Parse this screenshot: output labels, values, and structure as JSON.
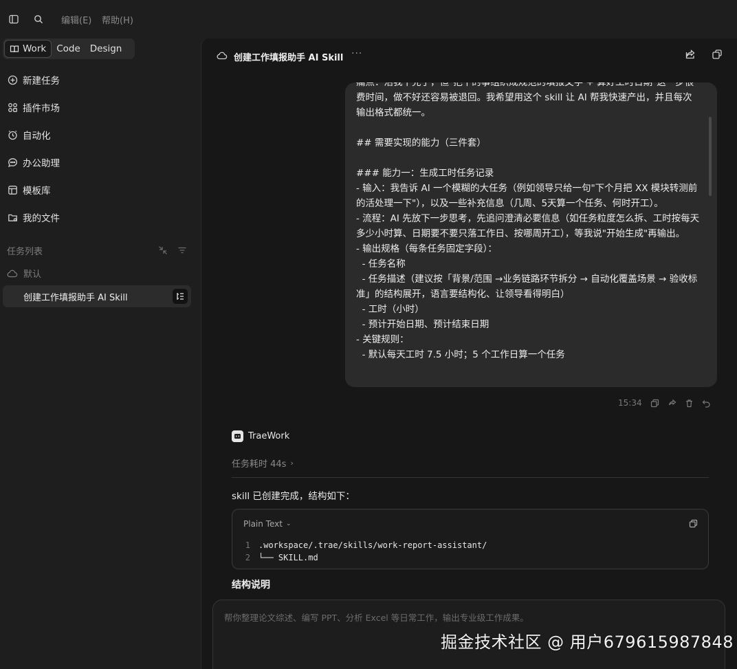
{
  "topbar": {
    "menu": [
      {
        "label": "编辑(E)"
      },
      {
        "label": "帮助(H)"
      }
    ]
  },
  "sidebar": {
    "modes": [
      {
        "label": "Work",
        "active": true
      },
      {
        "label": "Code",
        "active": false
      },
      {
        "label": "Design",
        "active": false
      }
    ],
    "nav": [
      {
        "label": "新建任务",
        "icon": "plus-circle-icon"
      },
      {
        "label": "插件市场",
        "icon": "plugins-icon"
      },
      {
        "label": "自动化",
        "icon": "clock-icon"
      },
      {
        "label": "办公助理",
        "icon": "chat-icon"
      },
      {
        "label": "模板库",
        "icon": "template-icon"
      },
      {
        "label": "我的文件",
        "icon": "folder-icon"
      }
    ],
    "tasks_header": "任务列表",
    "group_label": "默认",
    "active_task": "创建工作填报助手 AI Skill"
  },
  "main": {
    "title": "创建工作填报助手 AI Skill",
    "user_message": "痛点：活我干完了，但\"把干的事组织成规范的填报文字 + 算好工时日期\"这一步很费时间，做不好还容易被退回。我希望用这个 skill 让 AI 帮我快速产出，并且每次输出格式都统一。\n\n## 需要实现的能力（三件套）\n\n### 能力一：生成工时任务记录\n- 输入：我告诉 AI 一个模糊的大任务（例如领导只给一句\"下个月把 XX 模块转测前的活处理一下\"），以及一些补充信息（几周、5天算一个任务、何时开工）。\n- 流程：AI 先放下一步思考，先追问澄清必要信息（如任务粒度怎么拆、工时按每天多少小时算、日期要不要只落工作日、按哪周开工），等我说\"开始生成\"再输出。\n- 输出规格（每条任务固定字段）：\n  - 任务名称\n  - 任务描述（建议按「背景/范围 →业务链路环节拆分 → 自动化覆盖场景 → 验收标准」的结构展开，语言要结构化、让领导看得明白）\n  - 工时（小时）\n  - 预计开始日期、预计结束日期\n- 关键规则：\n  - 默认每天工时 7.5 小时；5 个工作日算一个任务",
    "message_time": "15:34",
    "assistant": {
      "name": "TraeWork",
      "elapsed": "任务耗时 44s",
      "intro": "skill 已创建完成，结构如下：",
      "code_lang": "Plain Text",
      "code_lines": [
        {
          "num": "1",
          "text": ".workspace/.trae/skills/work-report-assistant/"
        },
        {
          "num": "2",
          "text": "└── SKILL.md"
        }
      ],
      "section_title": "结构说明"
    },
    "composer_placeholder": "帮你整理论文综述、编写 PPT、分析 Excel 等日常工作，输出专业级工作成果。"
  },
  "watermark": "掘金技术社区 @ 用户679615987848",
  "colors": {
    "background": "#1e1e1e",
    "panel": "#171717",
    "bubble": "#2b2b2b",
    "accent": "#6b4cf0"
  }
}
